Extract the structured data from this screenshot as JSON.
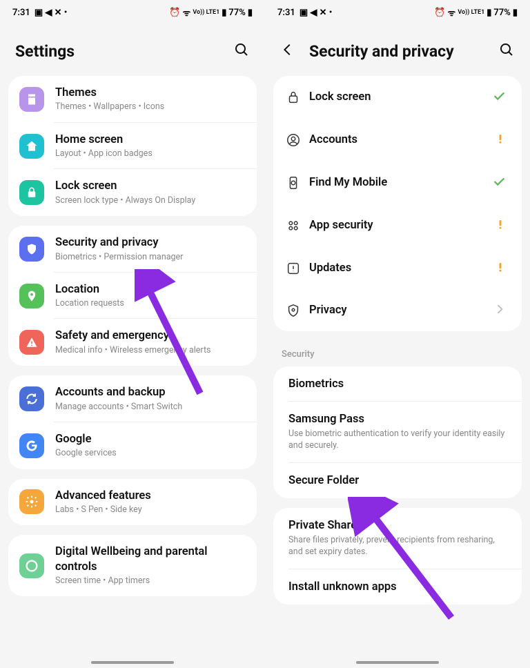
{
  "status": {
    "time": "7:31",
    "battery": "77%",
    "net": "Vo)) LTE1"
  },
  "left": {
    "title": "Settings",
    "groups": [
      [
        {
          "title": "Themes",
          "sub": "Themes  •  Wallpapers  •  Icons",
          "color": "#b895ea",
          "icon": "themes"
        },
        {
          "title": "Home screen",
          "sub": "Layout  •  App icon badges",
          "color": "#1fc0cf",
          "icon": "home"
        },
        {
          "title": "Lock screen",
          "sub": "Screen lock type  •  Always On Display",
          "color": "#1dc4a2",
          "icon": "lock"
        }
      ],
      [
        {
          "title": "Security and privacy",
          "sub": "Biometrics  •  Permission manager",
          "color": "#5b6ff0",
          "icon": "shield"
        },
        {
          "title": "Location",
          "sub": "Location requests",
          "color": "#55c15b",
          "icon": "location"
        },
        {
          "title": "Safety and emergency",
          "sub": "Medical info  •  Wireless emergency alerts",
          "color": "#f0655a",
          "icon": "emergency"
        }
      ],
      [
        {
          "title": "Accounts and backup",
          "sub": "Manage accounts  •  Smart Switch",
          "color": "#4a70d8",
          "icon": "backup"
        },
        {
          "title": "Google",
          "sub": "Google services",
          "color": "#4285f4",
          "icon": "google"
        }
      ],
      [
        {
          "title": "Advanced features",
          "sub": "Labs  •  S Pen  •  Side key",
          "color": "#f5a73c",
          "icon": "advanced"
        }
      ],
      [
        {
          "title": "Digital Wellbeing and parental controls",
          "sub": "Screen time  •  App timers",
          "color": "#6fd095",
          "icon": "wellbeing"
        }
      ]
    ]
  },
  "right": {
    "title": "Security and privacy",
    "statusRows": [
      {
        "title": "Lock screen",
        "icon": "lock",
        "status": "check"
      },
      {
        "title": "Accounts",
        "icon": "account",
        "status": "warn"
      },
      {
        "title": "Find My Mobile",
        "icon": "find",
        "status": "check"
      },
      {
        "title": "App security",
        "icon": "apps",
        "status": "warn"
      },
      {
        "title": "Updates",
        "icon": "updates",
        "status": "warn"
      },
      {
        "title": "Privacy",
        "icon": "privacy",
        "status": "arrow"
      }
    ],
    "securityLabel": "Security",
    "items1": [
      {
        "title": "Biometrics",
        "sub": ""
      },
      {
        "title": "Samsung Pass",
        "sub": "Use biometric authentication to verify your identity easily and securely."
      },
      {
        "title": "Secure Folder",
        "sub": ""
      }
    ],
    "items2": [
      {
        "title": "Private Share",
        "sub": "Share files privately, prevent recipients from resharing, and set expiry dates."
      },
      {
        "title": "Install unknown apps",
        "sub": ""
      }
    ]
  }
}
